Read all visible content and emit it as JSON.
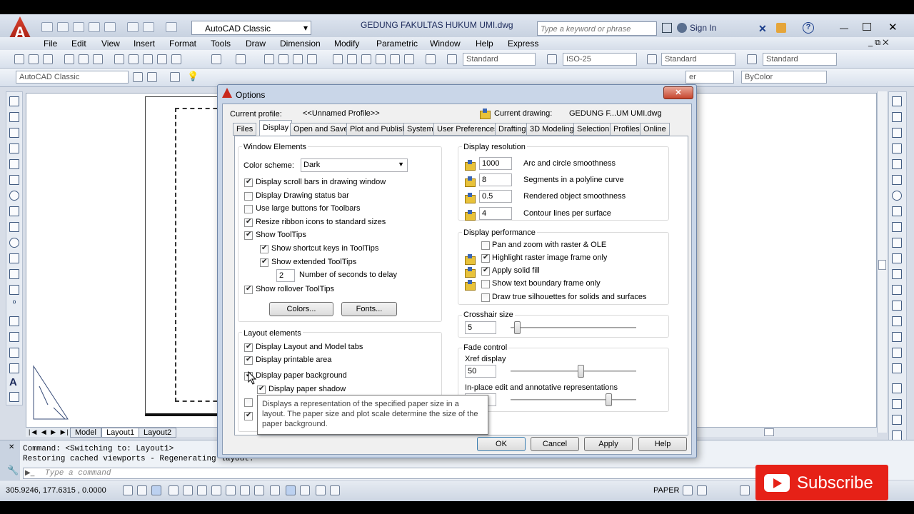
{
  "app": {
    "workspace": "AutoCAD Classic",
    "title": "GEDUNG FAKULTAS HUKUM UMI.dwg",
    "search_placeholder": "Type a keyword or phrase",
    "sign_in": "Sign In"
  },
  "menu": [
    "File",
    "Edit",
    "View",
    "Insert",
    "Format",
    "Tools",
    "Draw",
    "Dimension",
    "Modify",
    "Parametric",
    "Window",
    "Help",
    "Express"
  ],
  "toolbar": {
    "text_style": "Standard",
    "dim_style": "ISO-25",
    "table_style": "Standard",
    "mleader_style": "Standard",
    "workspace2": "AutoCAD Classic",
    "layer_tail": "er",
    "color": "ByColor"
  },
  "layout_tabs": [
    "Model",
    "Layout1",
    "Layout2"
  ],
  "command": {
    "line1": "Command:   <Switching to: Layout1>",
    "line2": "Restoring cached viewports - Regenerating layout.",
    "prompt": "Type a command"
  },
  "status": {
    "coords": "305.9246,  177.6315 , 0.0000",
    "paper": "PAPER"
  },
  "dialog": {
    "title": "Options",
    "current_profile_label": "Current profile:",
    "current_profile": "<<Unnamed Profile>>",
    "current_drawing_label": "Current drawing:",
    "current_drawing": "GEDUNG F...UM UMI.dwg",
    "tabs": [
      "Files",
      "Display",
      "Open and Save",
      "Plot and Publish",
      "System",
      "User Preferences",
      "Drafting",
      "3D Modeling",
      "Selection",
      "Profiles",
      "Online"
    ],
    "active_tab": "Display",
    "window_elements": {
      "title": "Window Elements",
      "color_scheme_label": "Color scheme:",
      "color_scheme": "Dark",
      "options": [
        {
          "label": "Display scroll bars in drawing window",
          "checked": true
        },
        {
          "label": "Display Drawing status bar",
          "checked": false
        },
        {
          "label": "Use large buttons for Toolbars",
          "checked": false
        },
        {
          "label": "Resize ribbon icons to standard sizes",
          "checked": true
        },
        {
          "label": "Show ToolTips",
          "checked": true
        },
        {
          "label": "Show shortcut keys in ToolTips",
          "checked": true
        },
        {
          "label": "Show extended ToolTips",
          "checked": true
        }
      ],
      "delay_value": "2",
      "delay_label": "Number of seconds to delay",
      "rollover": {
        "label": "Show rollover ToolTips",
        "checked": true
      },
      "colors_button": "Colors...",
      "fonts_button": "Fonts..."
    },
    "layout_elements": {
      "title": "Layout elements",
      "options": [
        {
          "label": "Display Layout and Model tabs",
          "checked": true
        },
        {
          "label": "Display printable area",
          "checked": true
        },
        {
          "label": "Display paper background",
          "checked": true
        },
        {
          "label": "Display paper shadow",
          "checked": true
        }
      ]
    },
    "display_resolution": {
      "title": "Display resolution",
      "rows": [
        {
          "value": "1000",
          "label": "Arc and circle smoothness"
        },
        {
          "value": "8",
          "label": "Segments in a polyline curve"
        },
        {
          "value": "0.5",
          "label": "Rendered object smoothness"
        },
        {
          "value": "4",
          "label": "Contour lines per surface"
        }
      ]
    },
    "display_performance": {
      "title": "Display performance",
      "options": [
        {
          "label": "Pan and zoom with raster & OLE",
          "checked": false
        },
        {
          "label": "Highlight raster image frame only",
          "checked": true
        },
        {
          "label": "Apply solid fill",
          "checked": true
        },
        {
          "label": "Show text boundary frame only",
          "checked": false
        },
        {
          "label": "Draw true silhouettes for solids and surfaces",
          "checked": false
        }
      ]
    },
    "crosshair": {
      "title": "Crosshair size",
      "value": "5",
      "level": 5
    },
    "fade": {
      "title": "Fade control",
      "xref_label": "Xref display",
      "xref_value": "50",
      "xref_level": 50,
      "inplace_label": "In-place edit and annotative representations",
      "inplace_level": 70
    },
    "tooltip": "Displays a representation of the specified paper size in a layout. The paper size and plot scale determine the size of the paper background.",
    "buttons": {
      "ok": "OK",
      "cancel": "Cancel",
      "apply": "Apply",
      "help": "Help"
    }
  },
  "subscribe": "Subscribe"
}
